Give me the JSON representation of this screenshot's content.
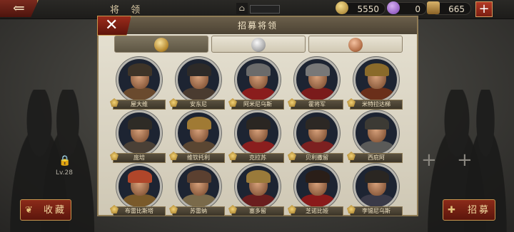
{
  "topbar": {
    "back_glyph": "⇐",
    "title": "将 领",
    "temple_value": "",
    "resources": [
      {
        "name": "gold",
        "value": "5550",
        "icon": "gold-coin-icon",
        "color": "#c9a24a"
      },
      {
        "name": "gem",
        "value": "0",
        "icon": "purple-gem-icon",
        "color": "#8a4fc4"
      },
      {
        "name": "recruit-tokens",
        "value": "665",
        "icon": "recruit-scroll-icon",
        "color": "#a38457"
      }
    ],
    "plus_label": "+"
  },
  "side": {
    "collect_label": "收藏",
    "recruit_label": "招募",
    "lock_level": "Lv.28",
    "plus_glyph": "+"
  },
  "dialog": {
    "title": "招募将领",
    "close_glyph": "✕",
    "tabs": [
      {
        "tier": "gold",
        "active": true
      },
      {
        "tier": "silver",
        "active": false
      },
      {
        "tier": "bronze",
        "active": false
      }
    ],
    "generals": [
      {
        "name": "屋大维"
      },
      {
        "name": "安东尼"
      },
      {
        "name": "阿米尼乌斯"
      },
      {
        "name": "霍将军"
      },
      {
        "name": "米特拉达梯"
      },
      {
        "name": "庞培"
      },
      {
        "name": "维钦托利"
      },
      {
        "name": "克拉苏"
      },
      {
        "name": "贝利撒留"
      },
      {
        "name": "西庇阿"
      },
      {
        "name": "布雷比斯塔"
      },
      {
        "name": "苏雷纳"
      },
      {
        "name": "塞多留"
      },
      {
        "name": "芝诺比娅"
      },
      {
        "name": "李锡尼乌斯"
      }
    ]
  }
}
